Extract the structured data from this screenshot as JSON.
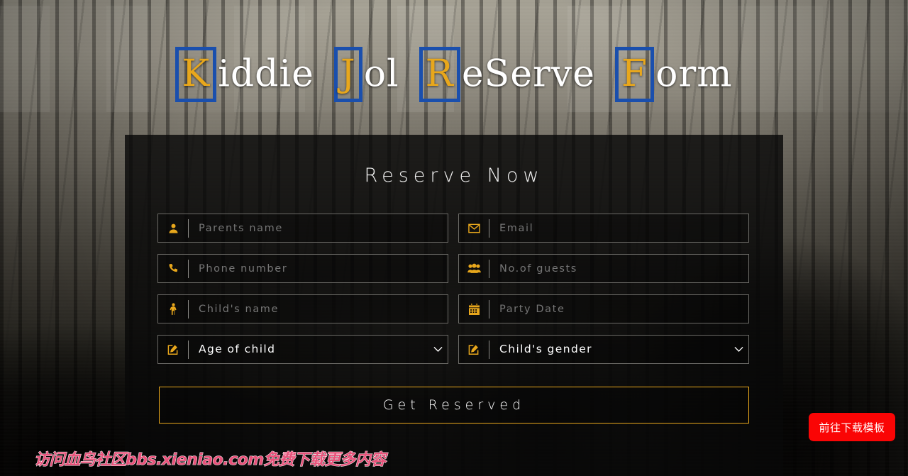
{
  "header": {
    "title_full": "Kiddie Jol ReServe Form",
    "words": [
      {
        "initial": "K",
        "rest": "iddie"
      },
      {
        "initial": "J",
        "rest": "ol"
      },
      {
        "initial": "R",
        "rest": "eServe"
      },
      {
        "initial": "F",
        "rest": "orm"
      }
    ],
    "accent_color": "#e8a71c",
    "box_color": "#1a4fad"
  },
  "form": {
    "heading": "Reserve Now",
    "fields": [
      {
        "name": "parents-name",
        "icon": "user-icon",
        "placeholder": "Parents name",
        "value": "",
        "type": "text"
      },
      {
        "name": "email",
        "icon": "envelope-icon",
        "placeholder": "Email",
        "value": "",
        "type": "text"
      },
      {
        "name": "phone-number",
        "icon": "phone-icon",
        "placeholder": "Phone number",
        "value": "",
        "type": "text"
      },
      {
        "name": "guests",
        "icon": "users-icon",
        "placeholder": "No.of guests",
        "value": "",
        "type": "text"
      },
      {
        "name": "child-name",
        "icon": "child-icon",
        "placeholder": "Child's name",
        "value": "",
        "type": "text"
      },
      {
        "name": "party-date",
        "icon": "calendar-icon",
        "placeholder": "Party Date",
        "value": "",
        "type": "text"
      },
      {
        "name": "age-of-child",
        "icon": "edit-icon",
        "placeholder": "",
        "value": "Age of child",
        "type": "select"
      },
      {
        "name": "child-gender",
        "icon": "edit-icon",
        "placeholder": "",
        "value": "Child's gender",
        "type": "select"
      }
    ],
    "submit_label": "Get Reserved"
  },
  "overlay": {
    "download_label": "前往下载模板",
    "download_color": "#fa0505",
    "watermark_text": "访问血鸟社区bbs.xieniao.com免费下载更多内容",
    "watermark_color": "#e8527a"
  }
}
